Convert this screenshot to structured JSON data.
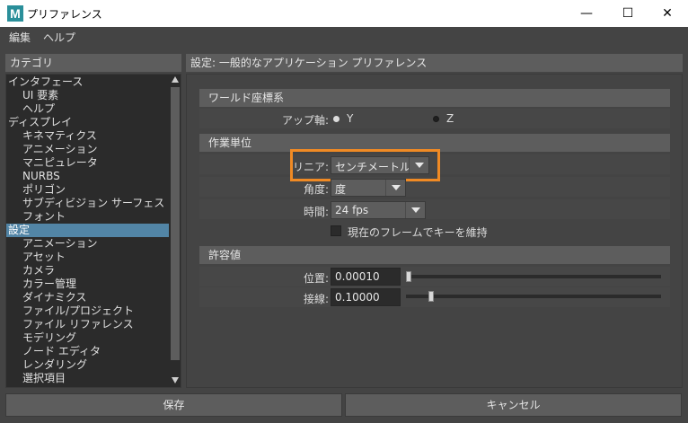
{
  "window": {
    "icon_letter": "M",
    "title": "プリファレンス",
    "controls": {
      "minimize": "—",
      "maximize": "☐",
      "close": "✕"
    }
  },
  "menubar": [
    "編集",
    "ヘルプ"
  ],
  "categories": {
    "header": "カテゴリ",
    "items": [
      {
        "label": "インタフェース",
        "level": 0,
        "selected": false
      },
      {
        "label": "UI 要素",
        "level": 1,
        "selected": false
      },
      {
        "label": "ヘルプ",
        "level": 1,
        "selected": false
      },
      {
        "label": "ディスプレイ",
        "level": 0,
        "selected": false
      },
      {
        "label": "キネマティクス",
        "level": 1,
        "selected": false
      },
      {
        "label": "アニメーション",
        "level": 1,
        "selected": false
      },
      {
        "label": "マニピュレータ",
        "level": 1,
        "selected": false
      },
      {
        "label": "NURBS",
        "level": 1,
        "selected": false
      },
      {
        "label": "ポリゴン",
        "level": 1,
        "selected": false
      },
      {
        "label": "サブディビジョン サーフェス",
        "level": 1,
        "selected": false
      },
      {
        "label": "フォント",
        "level": 1,
        "selected": false
      },
      {
        "label": "設定",
        "level": 0,
        "selected": true
      },
      {
        "label": "アニメーション",
        "level": 1,
        "selected": false
      },
      {
        "label": "アセット",
        "level": 1,
        "selected": false
      },
      {
        "label": "カメラ",
        "level": 1,
        "selected": false
      },
      {
        "label": "カラー管理",
        "level": 1,
        "selected": false
      },
      {
        "label": "ダイナミクス",
        "level": 1,
        "selected": false
      },
      {
        "label": "ファイル/プロジェクト",
        "level": 1,
        "selected": false
      },
      {
        "label": "ファイル リファレンス",
        "level": 1,
        "selected": false
      },
      {
        "label": "モデリング",
        "level": 1,
        "selected": false
      },
      {
        "label": "ノード エディタ",
        "level": 1,
        "selected": false
      },
      {
        "label": "レンダリング",
        "level": 1,
        "selected": false
      },
      {
        "label": "選択項目",
        "level": 1,
        "selected": false
      }
    ]
  },
  "main": {
    "header": "設定: 一般的なアプリケーション プリファレンス",
    "world_coords": {
      "title": "ワールド座標系",
      "up_axis_label": "アップ軸:",
      "options": [
        {
          "label": "Y",
          "selected": true
        },
        {
          "label": "Z",
          "selected": false
        }
      ]
    },
    "working_units": {
      "title": "作業単位",
      "linear_label": "リニア:",
      "linear_value": "センチメートル",
      "angle_label": "角度:",
      "angle_value": "度",
      "time_label": "時間:",
      "time_value": "24 fps",
      "keep_keys_label": "現在のフレームでキーを維持",
      "keep_keys_checked": false
    },
    "tolerance": {
      "title": "許容値",
      "position_label": "位置:",
      "position_value": "0.00010",
      "position_fraction": 0.01,
      "tangent_label": "接線:",
      "tangent_value": "0.10000",
      "tangent_fraction": 0.1
    }
  },
  "buttons": {
    "save": "保存",
    "cancel": "キャンセル"
  },
  "colors": {
    "highlight": "#f08a24",
    "selection": "#5285a6"
  }
}
